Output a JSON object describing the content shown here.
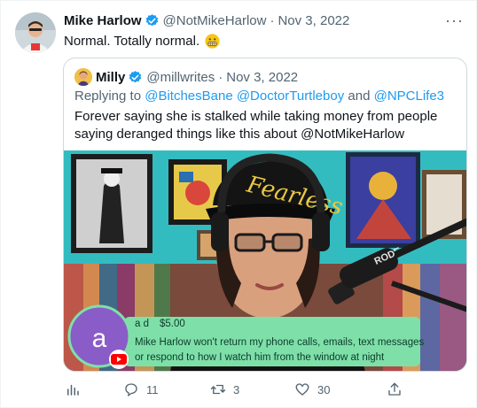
{
  "tweet": {
    "author_name": "Mike Harlow",
    "author_handle": "@NotMikeHarlow",
    "separator": "·",
    "date": "Nov 3, 2022",
    "text": "Normal. Totally normal.",
    "more_label": "···"
  },
  "quoted": {
    "author_name": "Milly",
    "author_handle": "@millwrites",
    "separator": "·",
    "date": "Nov 3, 2022",
    "replying_prefix": "Replying to",
    "replying_users": "@BitchesBane @DoctorTurtleboy",
    "replying_and": "and",
    "replying_last": "@NPCLife3",
    "text": "Forever saying she is stalked while taking money from people saying deranged things like this about @NotMikeHarlow",
    "media": {
      "hat_text": "Fearless",
      "donor_initial": "a",
      "donor_name": "a d",
      "donation_amount": "$5.00",
      "donation_message_line1": "Mike Harlow won't return my phone calls, emails, text messages",
      "donation_message_line2": "or respond to how I watch him from the window at night",
      "mic_label": "RODE"
    }
  },
  "actions": {
    "replies": "11",
    "retweets": "3",
    "likes": "30"
  },
  "colors": {
    "verified": "#1d9bf0",
    "muted": "#536471",
    "donation_green": "#7ee0a8"
  }
}
